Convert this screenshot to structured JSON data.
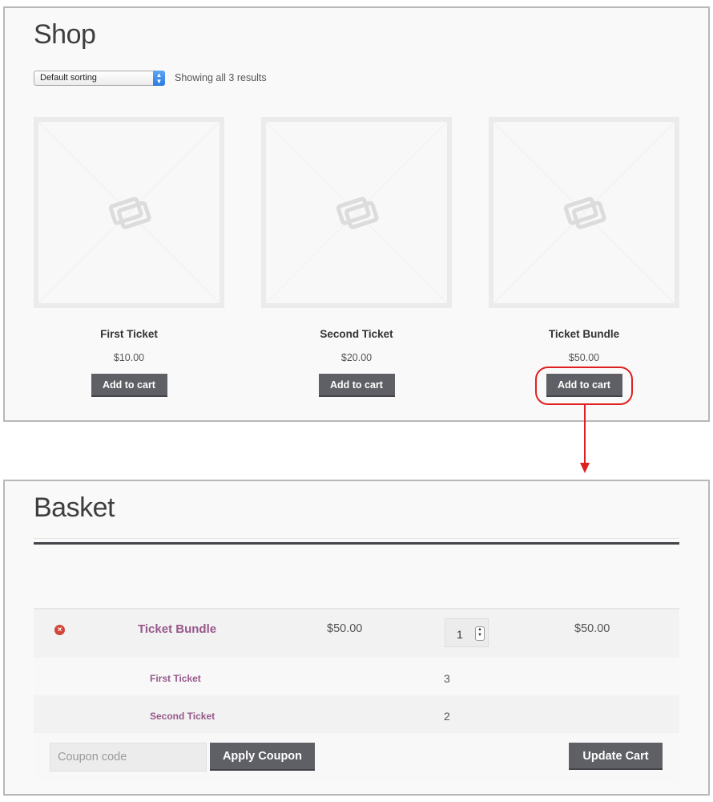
{
  "shop": {
    "title": "Shop",
    "sorting": {
      "selected": "Default sorting"
    },
    "result_count": "Showing all 3 results",
    "products": [
      {
        "name": "First Ticket",
        "price": "$10.00",
        "button": "Add to cart"
      },
      {
        "name": "Second Ticket",
        "price": "$20.00",
        "button": "Add to cart"
      },
      {
        "name": "Ticket Bundle",
        "price": "$50.00",
        "button": "Add to cart"
      }
    ]
  },
  "basket": {
    "title": "Basket",
    "item": {
      "name": "Ticket Bundle",
      "price": "$50.00",
      "quantity": "1",
      "subtotal": "$50.00"
    },
    "bundled_items": [
      {
        "name": "First Ticket",
        "quantity": "3"
      },
      {
        "name": "Second Ticket",
        "quantity": "2"
      }
    ],
    "coupon_placeholder": "Coupon code",
    "apply_coupon_label": "Apply Coupon",
    "update_cart_label": "Update Cart"
  },
  "colors": {
    "highlight": "#e02020",
    "button_bg": "#5f6066",
    "link": "#96588a"
  },
  "icons": {
    "remove": "remove-circle-icon",
    "placeholder": "image-placeholder-icon",
    "arrow": "arrow-down-icon"
  }
}
